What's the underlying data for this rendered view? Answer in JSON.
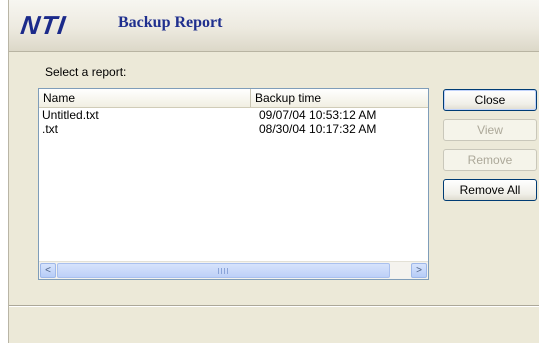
{
  "header": {
    "logo": "NTI",
    "title": "Backup Report"
  },
  "prompt": "Select a report:",
  "list": {
    "columns": [
      "Name",
      "Backup time"
    ],
    "rows": [
      {
        "name": "Untitled.txt",
        "time": "09/07/04 10:53:12 AM"
      },
      {
        "name": ".txt",
        "time": "08/30/04 10:17:32 AM"
      }
    ]
  },
  "buttons": {
    "close": "Close",
    "view": "View",
    "remove": "Remove",
    "remove_all": "Remove All"
  },
  "scrollbar": {
    "left_arrow": "<",
    "right_arrow": ">"
  }
}
